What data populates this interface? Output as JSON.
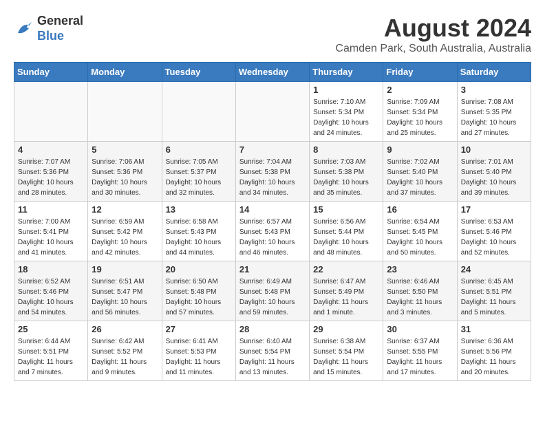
{
  "header": {
    "logo_general": "General",
    "logo_blue": "Blue",
    "month_year": "August 2024",
    "location": "Camden Park, South Australia, Australia"
  },
  "days_of_week": [
    "Sunday",
    "Monday",
    "Tuesday",
    "Wednesday",
    "Thursday",
    "Friday",
    "Saturday"
  ],
  "weeks": [
    [
      {
        "day": "",
        "info": ""
      },
      {
        "day": "",
        "info": ""
      },
      {
        "day": "",
        "info": ""
      },
      {
        "day": "",
        "info": ""
      },
      {
        "day": "1",
        "info": "Sunrise: 7:10 AM\nSunset: 5:34 PM\nDaylight: 10 hours\nand 24 minutes."
      },
      {
        "day": "2",
        "info": "Sunrise: 7:09 AM\nSunset: 5:34 PM\nDaylight: 10 hours\nand 25 minutes."
      },
      {
        "day": "3",
        "info": "Sunrise: 7:08 AM\nSunset: 5:35 PM\nDaylight: 10 hours\nand 27 minutes."
      }
    ],
    [
      {
        "day": "4",
        "info": "Sunrise: 7:07 AM\nSunset: 5:36 PM\nDaylight: 10 hours\nand 28 minutes."
      },
      {
        "day": "5",
        "info": "Sunrise: 7:06 AM\nSunset: 5:36 PM\nDaylight: 10 hours\nand 30 minutes."
      },
      {
        "day": "6",
        "info": "Sunrise: 7:05 AM\nSunset: 5:37 PM\nDaylight: 10 hours\nand 32 minutes."
      },
      {
        "day": "7",
        "info": "Sunrise: 7:04 AM\nSunset: 5:38 PM\nDaylight: 10 hours\nand 34 minutes."
      },
      {
        "day": "8",
        "info": "Sunrise: 7:03 AM\nSunset: 5:38 PM\nDaylight: 10 hours\nand 35 minutes."
      },
      {
        "day": "9",
        "info": "Sunrise: 7:02 AM\nSunset: 5:40 PM\nDaylight: 10 hours\nand 37 minutes."
      },
      {
        "day": "10",
        "info": "Sunrise: 7:01 AM\nSunset: 5:40 PM\nDaylight: 10 hours\nand 39 minutes."
      }
    ],
    [
      {
        "day": "11",
        "info": "Sunrise: 7:00 AM\nSunset: 5:41 PM\nDaylight: 10 hours\nand 41 minutes."
      },
      {
        "day": "12",
        "info": "Sunrise: 6:59 AM\nSunset: 5:42 PM\nDaylight: 10 hours\nand 42 minutes."
      },
      {
        "day": "13",
        "info": "Sunrise: 6:58 AM\nSunset: 5:43 PM\nDaylight: 10 hours\nand 44 minutes."
      },
      {
        "day": "14",
        "info": "Sunrise: 6:57 AM\nSunset: 5:43 PM\nDaylight: 10 hours\nand 46 minutes."
      },
      {
        "day": "15",
        "info": "Sunrise: 6:56 AM\nSunset: 5:44 PM\nDaylight: 10 hours\nand 48 minutes."
      },
      {
        "day": "16",
        "info": "Sunrise: 6:54 AM\nSunset: 5:45 PM\nDaylight: 10 hours\nand 50 minutes."
      },
      {
        "day": "17",
        "info": "Sunrise: 6:53 AM\nSunset: 5:46 PM\nDaylight: 10 hours\nand 52 minutes."
      }
    ],
    [
      {
        "day": "18",
        "info": "Sunrise: 6:52 AM\nSunset: 5:46 PM\nDaylight: 10 hours\nand 54 minutes."
      },
      {
        "day": "19",
        "info": "Sunrise: 6:51 AM\nSunset: 5:47 PM\nDaylight: 10 hours\nand 56 minutes."
      },
      {
        "day": "20",
        "info": "Sunrise: 6:50 AM\nSunset: 5:48 PM\nDaylight: 10 hours\nand 57 minutes."
      },
      {
        "day": "21",
        "info": "Sunrise: 6:49 AM\nSunset: 5:48 PM\nDaylight: 10 hours\nand 59 minutes."
      },
      {
        "day": "22",
        "info": "Sunrise: 6:47 AM\nSunset: 5:49 PM\nDaylight: 11 hours\nand 1 minute."
      },
      {
        "day": "23",
        "info": "Sunrise: 6:46 AM\nSunset: 5:50 PM\nDaylight: 11 hours\nand 3 minutes."
      },
      {
        "day": "24",
        "info": "Sunrise: 6:45 AM\nSunset: 5:51 PM\nDaylight: 11 hours\nand 5 minutes."
      }
    ],
    [
      {
        "day": "25",
        "info": "Sunrise: 6:44 AM\nSunset: 5:51 PM\nDaylight: 11 hours\nand 7 minutes."
      },
      {
        "day": "26",
        "info": "Sunrise: 6:42 AM\nSunset: 5:52 PM\nDaylight: 11 hours\nand 9 minutes."
      },
      {
        "day": "27",
        "info": "Sunrise: 6:41 AM\nSunset: 5:53 PM\nDaylight: 11 hours\nand 11 minutes."
      },
      {
        "day": "28",
        "info": "Sunrise: 6:40 AM\nSunset: 5:54 PM\nDaylight: 11 hours\nand 13 minutes."
      },
      {
        "day": "29",
        "info": "Sunrise: 6:38 AM\nSunset: 5:54 PM\nDaylight: 11 hours\nand 15 minutes."
      },
      {
        "day": "30",
        "info": "Sunrise: 6:37 AM\nSunset: 5:55 PM\nDaylight: 11 hours\nand 17 minutes."
      },
      {
        "day": "31",
        "info": "Sunrise: 6:36 AM\nSunset: 5:56 PM\nDaylight: 11 hours\nand 20 minutes."
      }
    ]
  ]
}
